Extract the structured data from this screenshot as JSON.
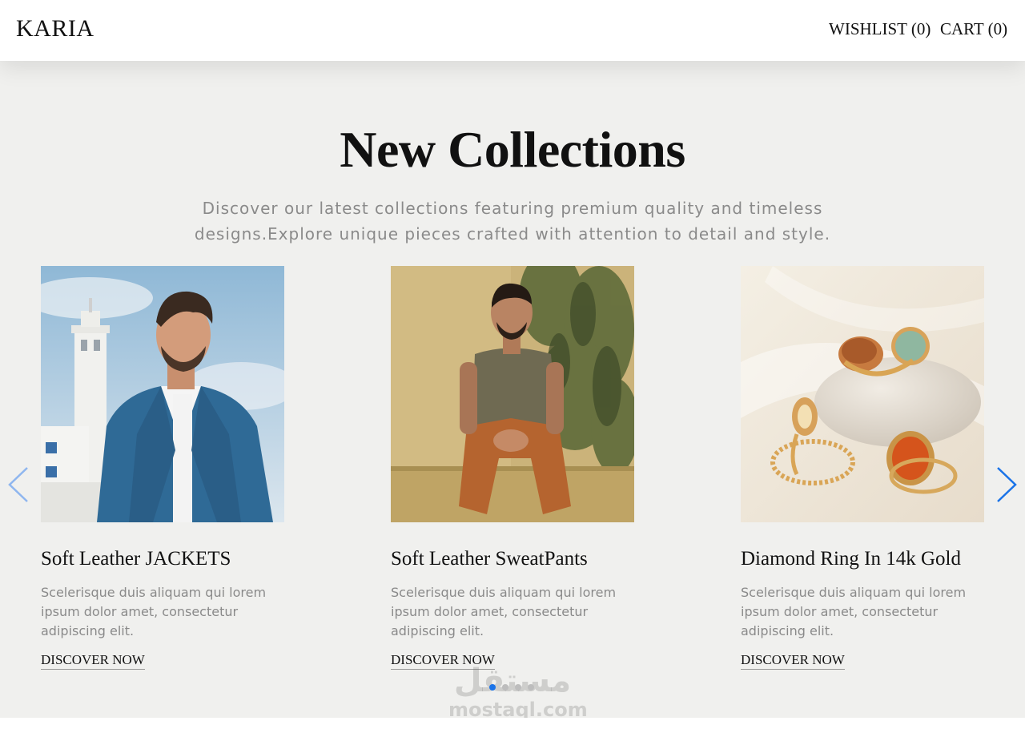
{
  "header": {
    "logo": "KARIA",
    "wishlist_label": "WISHLIST (0)",
    "cart_label": "CART (0)"
  },
  "section": {
    "title": "New Collections",
    "subtitle": "Discover our latest collections featuring premium quality and timeless designs.Explore unique pieces crafted with attention to detail and style."
  },
  "products": [
    {
      "title": "Soft Leather JACKETS",
      "description": "Scelerisque duis aliquam qui lorem ipsum dolor amet, consectetur adipiscing elit.",
      "link": "DISCOVER NOW",
      "image": "man-in-denim-jacket-photo"
    },
    {
      "title": "Soft Leather SweatPants",
      "description": "Scelerisque duis aliquam qui lorem ipsum dolor amet, consectetur adipiscing elit.",
      "link": "DISCOVER NOW",
      "image": "man-sitting-in-sweatpants-photo"
    },
    {
      "title": "Diamond Ring In 14k Gold",
      "description": "Scelerisque duis aliquam qui lorem ipsum dolor amet, consectetur adipiscing elit.",
      "link": "DISCOVER NOW",
      "image": "gold-rings-on-stone-photo"
    }
  ],
  "slider": {
    "prev_icon": "chevron-left-icon",
    "next_icon": "chevron-right-icon",
    "dot_count": 4,
    "active_dot": 1,
    "accent_color": "#1a73e8"
  },
  "watermark": {
    "arabic": "مستقل",
    "latin": "mostaql.com"
  }
}
